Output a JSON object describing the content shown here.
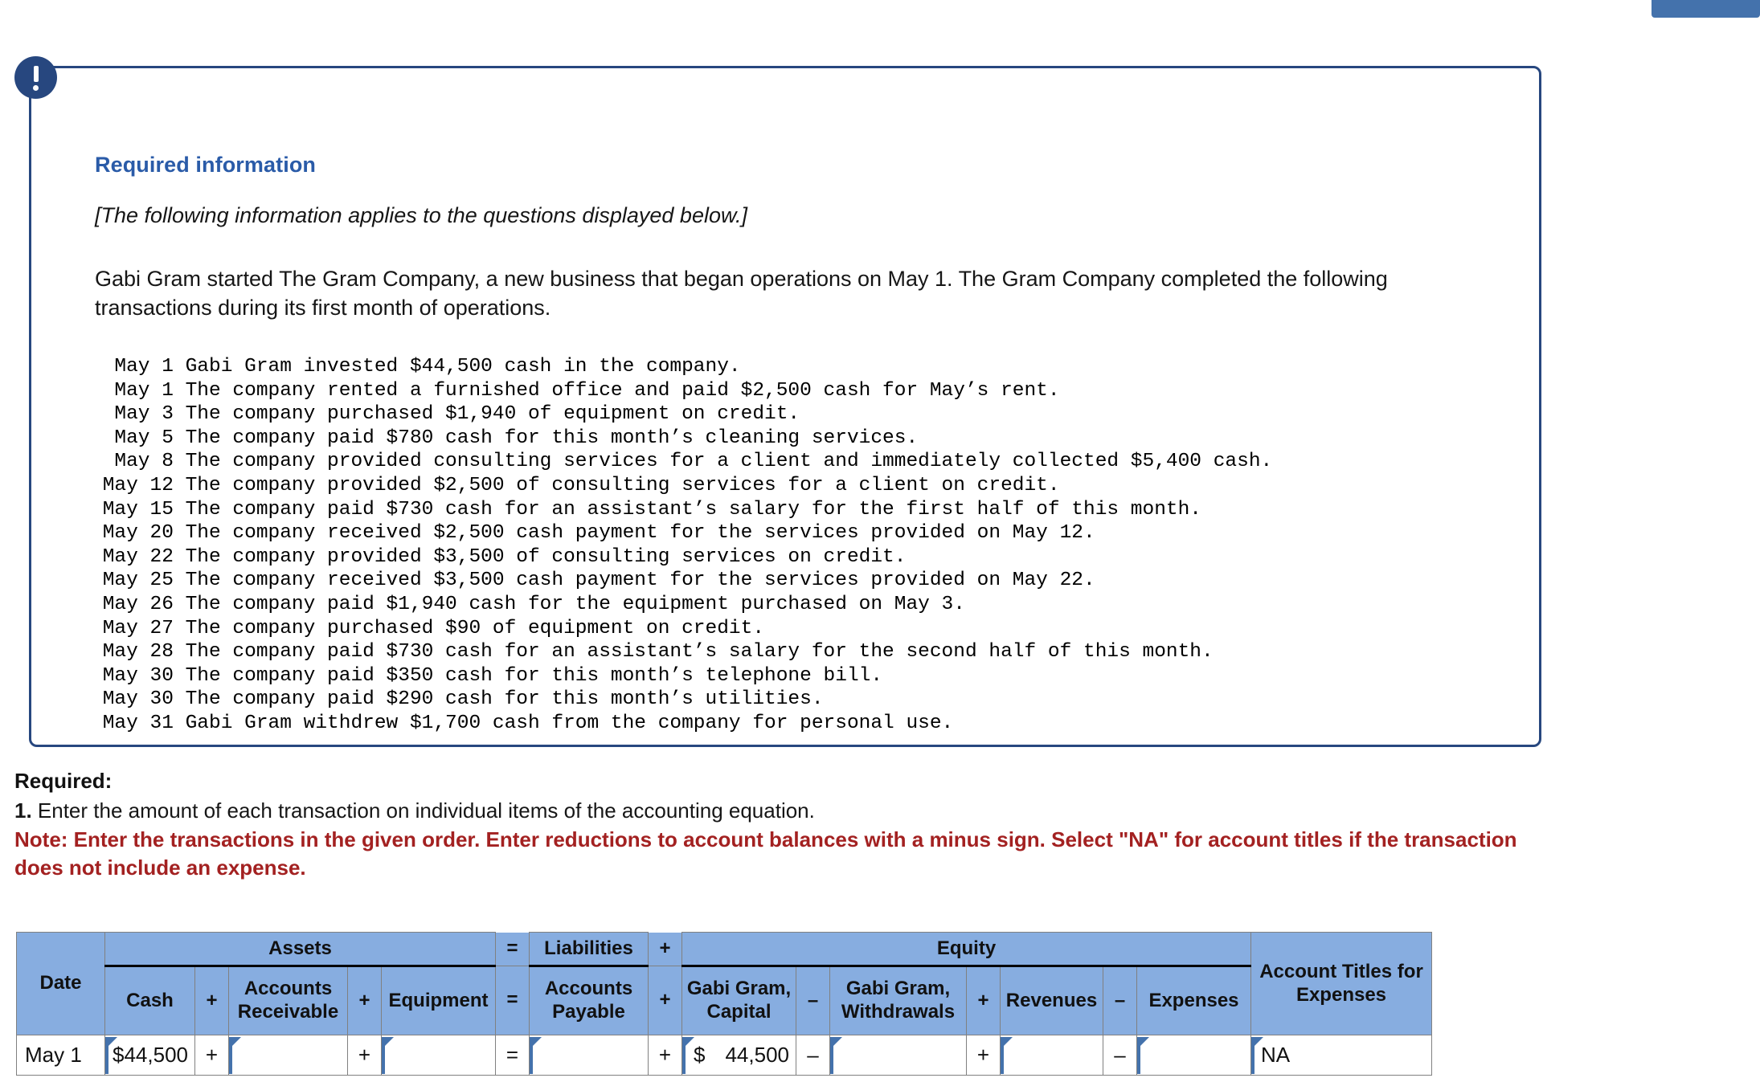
{
  "top_button": {
    "label": ""
  },
  "callout": {
    "icon": "exclamation-icon",
    "title": "Required information",
    "applies_note": "[The following information applies to the questions displayed below.]",
    "intro": "Gabi Gram started The Gram Company, a new business that began operations on May 1. The Gram Company completed the following transactions during its first month of operations.",
    "transactions": [
      {
        "date": "May 1",
        "text": "Gabi Gram invested $44,500 cash in the company."
      },
      {
        "date": "May 1",
        "text": "The company rented a furnished office and paid $2,500 cash for May’s rent."
      },
      {
        "date": "May 3",
        "text": "The company purchased $1,940 of equipment on credit."
      },
      {
        "date": "May 5",
        "text": "The company paid $780 cash for this month’s cleaning services."
      },
      {
        "date": "May 8",
        "text": "The company provided consulting services for a client and immediately collected $5,400 cash."
      },
      {
        "date": "May 12",
        "text": "The company provided $2,500 of consulting services for a client on credit."
      },
      {
        "date": "May 15",
        "text": "The company paid $730 cash for an assistant’s salary for the first half of this month."
      },
      {
        "date": "May 20",
        "text": "The company received $2,500 cash payment for the services provided on May 12."
      },
      {
        "date": "May 22",
        "text": "The company provided $3,500 of consulting services on credit."
      },
      {
        "date": "May 25",
        "text": "The company received $3,500 cash payment for the services provided on May 22."
      },
      {
        "date": "May 26",
        "text": "The company paid $1,940 cash for the equipment purchased on May 3."
      },
      {
        "date": "May 27",
        "text": "The company purchased $90 of equipment on credit."
      },
      {
        "date": "May 28",
        "text": "The company paid $730 cash for an assistant’s salary for the second half of this month."
      },
      {
        "date": "May 30",
        "text": "The company paid $350 cash for this month’s telephone bill."
      },
      {
        "date": "May 30",
        "text": "The company paid $290 cash for this month’s utilities."
      },
      {
        "date": "May 31",
        "text": "Gabi Gram withdrew $1,700 cash from the company for personal use."
      }
    ]
  },
  "required": {
    "heading": "Required:",
    "item_number": "1.",
    "item_text": " Enter the amount of each transaction on individual items of the accounting equation.",
    "note": "Note: Enter the transactions in the given order. Enter reductions to account balances with a minus sign. Select \"NA\" for account titles if the transaction does not include an expense."
  },
  "table": {
    "group_headers": {
      "assets": "Assets",
      "eq_sign_1": "=",
      "liabilities": "Liabilities",
      "plus_sign_1": "+",
      "equity": "Equity"
    },
    "sub_headers": {
      "date": "Date",
      "cash": "Cash",
      "op_plus_1": "+",
      "accounts_receivable": "Accounts Receivable",
      "op_plus_2": "+",
      "equipment": "Equipment",
      "op_equals": "=",
      "accounts_payable": "Accounts Payable",
      "op_plus_3": "+",
      "capital": "Gabi Gram, Capital",
      "op_minus_1": "–",
      "withdrawals": "Gabi Gram, Withdrawals",
      "op_plus_4": "+",
      "revenues": "Revenues",
      "op_minus_2": "–",
      "expenses": "Expenses",
      "account_titles": "Account Titles for Expenses"
    },
    "rows": [
      {
        "date": "May 1",
        "cash": "$44,500",
        "op1": "+",
        "accounts_receivable": "",
        "op2": "+",
        "equipment": "",
        "op3": "=",
        "accounts_payable": "",
        "op4": "+",
        "capital_currency": "$",
        "capital": "44,500",
        "op5": "–",
        "withdrawals": "",
        "op6": "+",
        "revenues": "",
        "op7": "–",
        "expenses": "",
        "account_title": "NA"
      }
    ]
  },
  "colors": {
    "header_blue": "#87ADE0",
    "navy": "#27477F",
    "link_blue": "#2A5BA8",
    "note_red": "#A32121",
    "input_accent": "#4472AC"
  }
}
